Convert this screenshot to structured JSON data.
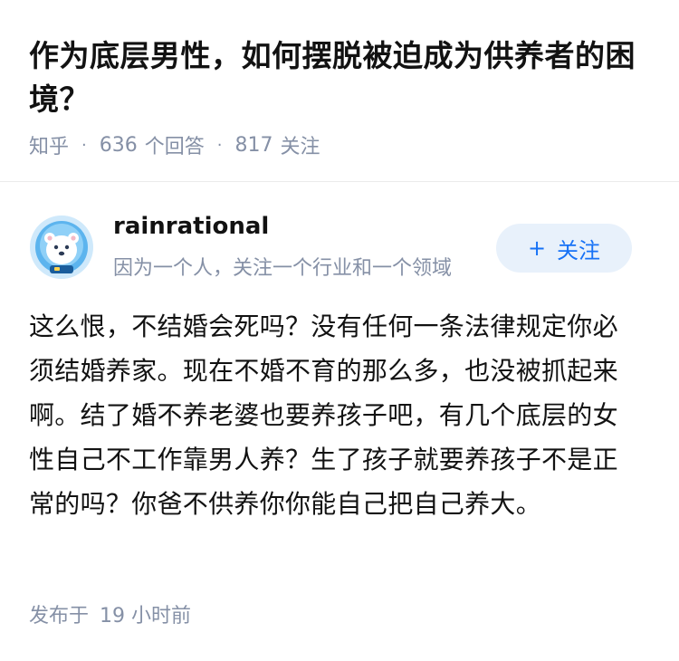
{
  "question": {
    "title": "作为底层男性，如何摆脱被迫成为供养者的困境？",
    "source": "知乎",
    "answer_count": "636",
    "answer_label": "个回答",
    "follower_count": "817",
    "follower_label": "关注"
  },
  "author": {
    "name": "rainrational",
    "headline": "因为一个人，关注一个行业和一个领域",
    "avatar_icon": "polar-bear-astronaut-avatar",
    "follow_label": "关注",
    "follow_icon": "plus-icon"
  },
  "answer": {
    "content": "这么恨，不结婚会死吗？没有任何一条法律规定你必须结婚养家。现在不婚不育的那么多，也没被抓起来啊。结了婚不养老婆也要养孩子吧，有几个底层的女性自己不工作靠男人养？生了孩子就要养孩子不是正常的吗？你爸不供养你你能自己把自己养大。",
    "publish_label": "发布于",
    "publish_time": "19 小时前"
  },
  "colors": {
    "text": "#121212",
    "meta": "#8590a6",
    "brand_blue": "#1772f6",
    "follow_bg": "#e8f1fb",
    "divider": "#ebebeb"
  }
}
